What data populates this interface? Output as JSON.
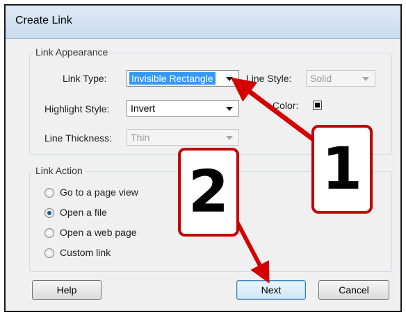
{
  "dialog": {
    "title": "Create Link"
  },
  "link_appearance": {
    "group_label": "Link Appearance",
    "link_type_label": "Link Type:",
    "link_type_value": "Invisible Rectangle",
    "line_style_label": "Line Style:",
    "line_style_value": "Solid",
    "highlight_style_label": "Highlight Style:",
    "highlight_style_value": "Invert",
    "color_label": "Color:",
    "line_thickness_label": "Line Thickness:",
    "line_thickness_value": "Thin"
  },
  "link_action": {
    "group_label": "Link Action",
    "options": [
      {
        "label": "Go to a page view",
        "checked": false
      },
      {
        "label": "Open a file",
        "checked": true
      },
      {
        "label": "Open a web page",
        "checked": false
      },
      {
        "label": "Custom link",
        "checked": false
      }
    ]
  },
  "buttons": {
    "help": "Help",
    "next": "Next",
    "cancel": "Cancel"
  },
  "annotations": {
    "callout_1": "1",
    "callout_2": "2",
    "color": "#c40000"
  }
}
